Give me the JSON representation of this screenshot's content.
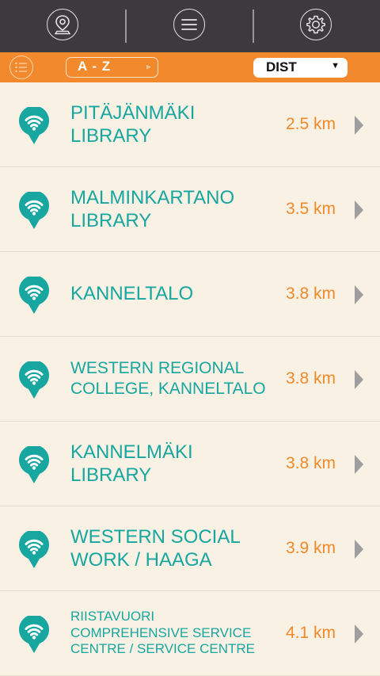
{
  "topbar": {
    "icons": [
      "location-pin-icon",
      "menu-icon",
      "gear-icon"
    ]
  },
  "filterbar": {
    "list_icon": "list-icon",
    "az_label": "A - Z",
    "az_arrow": "▹",
    "sort_value": "DIST",
    "sort_arrow": "▼"
  },
  "colors": {
    "topbar": "#3d3a3d",
    "accent_orange": "#f2892c",
    "teal": "#17a6a0",
    "background": "#f8f1e4"
  },
  "locations": [
    {
      "name": "PITÄJÄNMÄKI LIBRARY",
      "distance": "2.5 km"
    },
    {
      "name": "MALMINKARTANO LIBRARY",
      "distance": "3.5 km"
    },
    {
      "name": "KANNELTALO",
      "distance": "3.8 km"
    },
    {
      "name": "WESTERN REGIONAL COLLEGE, KANNELTALO",
      "distance": "3.8 km"
    },
    {
      "name": "KANNELMÄKI LIBRARY",
      "distance": "3.8 km"
    },
    {
      "name": "WESTERN SOCIAL WORK / HAAGA",
      "distance": "3.9 km"
    },
    {
      "name": "RIISTAVUORI COMPREHENSIVE SERVICE CENTRE / SERVICE CENTRE",
      "distance": "4.1 km"
    }
  ]
}
